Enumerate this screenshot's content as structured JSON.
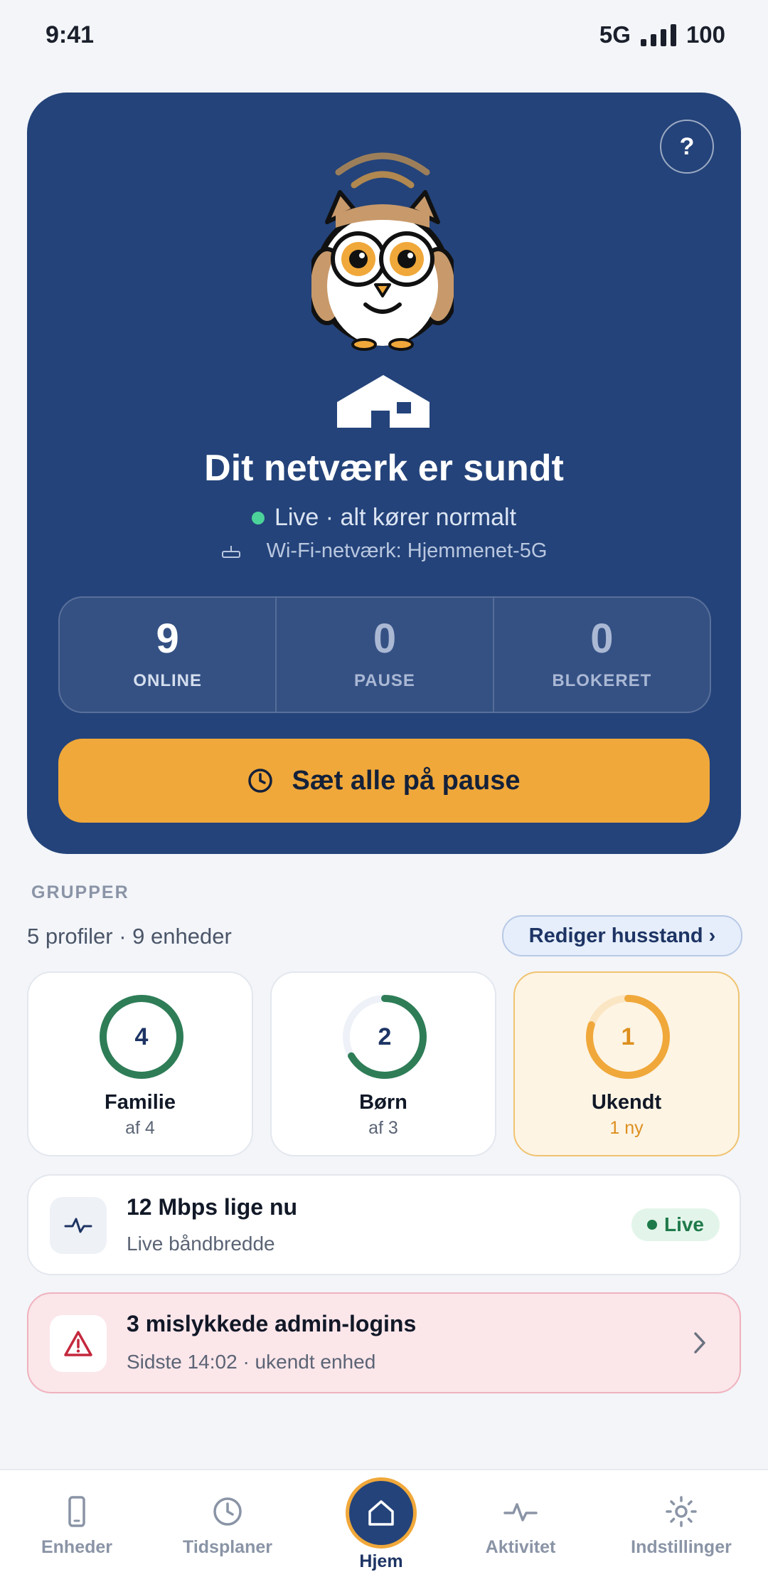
{
  "status_bar": {
    "time": "9:41",
    "network": "5G",
    "battery": "100"
  },
  "hero": {
    "help_label": "?",
    "title": "Dit netværk er sundt",
    "live_text": "Live · alt kører normalt",
    "wifi_text": "Wi-Fi-netværk: Hjemmenet-5G",
    "stats": [
      {
        "value": "9",
        "label": "ONLINE"
      },
      {
        "value": "0",
        "label": "PAUSE"
      },
      {
        "value": "0",
        "label": "BLOKERET"
      }
    ],
    "pause_button": "Sæt alle på pause"
  },
  "groups_section": {
    "label": "GRUPPER",
    "summary": "5 profiler · 9 enheder",
    "edit_button": "Rediger husstand ›",
    "groups": [
      {
        "name": "Familie",
        "count": "4",
        "sub": "af 4",
        "fill": 1.0,
        "color": "#2e7d57"
      },
      {
        "name": "Børn",
        "count": "2",
        "sub": "af 3",
        "fill": 0.6667,
        "color": "#2e7d57"
      },
      {
        "name": "Ukendt",
        "count": "1",
        "sub": "1 ny",
        "fill": 0.8,
        "color": "#f0a83a"
      }
    ]
  },
  "bandwidth": {
    "title": "12 Mbps lige nu",
    "subtitle": "Live båndbredde",
    "badge": "Live"
  },
  "alert": {
    "title": "3 mislykkede admin-logins",
    "subtitle": "Sidste 14:02 · ukendt enhed"
  },
  "tabs": [
    {
      "label": "Enheder",
      "icon": "phone-icon"
    },
    {
      "label": "Tidsplaner",
      "icon": "clock-icon"
    },
    {
      "label": "Hjem",
      "icon": "home-icon",
      "active": true
    },
    {
      "label": "Aktivitet",
      "icon": "activity-icon"
    },
    {
      "label": "Indstillinger",
      "icon": "settings-icon"
    }
  ]
}
